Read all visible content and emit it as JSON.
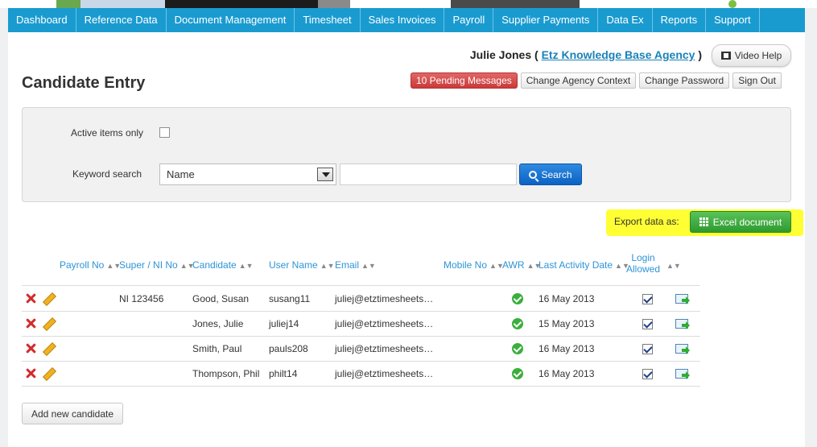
{
  "nav": {
    "items": [
      "Dashboard",
      "Reference Data",
      "Document Management",
      "Timesheet",
      "Sales Invoices",
      "Payroll",
      "Supplier Payments",
      "Data Ex",
      "Reports",
      "Support"
    ]
  },
  "header": {
    "user_name": "Julie Jones",
    "paren_open": "(",
    "agency": "Etz Knowledge Base Agency",
    "paren_close": ")",
    "video_help": "Video Help",
    "page_title": "Candidate Entry",
    "pending_messages": "10 Pending Messages",
    "change_agency": "Change Agency Context",
    "change_password": "Change Password",
    "sign_out": "Sign Out"
  },
  "filter": {
    "active_label": "Active items only",
    "keyword_label": "Keyword search",
    "select_value": "Name",
    "search_value": "",
    "search_button": "Search"
  },
  "export": {
    "label": "Export data as:",
    "excel": "Excel document",
    "highlight_color": "#ffff33"
  },
  "table": {
    "headers": [
      "Payroll No",
      "Super / NI No",
      "Candidate",
      "User Name",
      "Email",
      "Mobile No",
      "AWR",
      "Last Activity Date",
      "Login",
      "Allowed"
    ],
    "rows": [
      {
        "payroll": "",
        "ni": "NI 123456",
        "candidate": "Good, Susan",
        "username": "susang11",
        "email": "juliej@etztimesheets…",
        "mobile": "",
        "last_activity": "16 May 2013"
      },
      {
        "payroll": "",
        "ni": "",
        "candidate": "Jones, Julie",
        "username": "juliej14",
        "email": "juliej@etztimesheets…",
        "mobile": "",
        "last_activity": "15 May 2013"
      },
      {
        "payroll": "",
        "ni": "",
        "candidate": "Smith, Paul",
        "username": "pauls208",
        "email": "juliej@etztimesheets…",
        "mobile": "",
        "last_activity": "16 May 2013"
      },
      {
        "payroll": "",
        "ni": "",
        "candidate": "Thompson, Phil",
        "username": "philt14",
        "email": "juliej@etztimesheets…",
        "mobile": "",
        "last_activity": "16 May 2013"
      }
    ]
  },
  "actions": {
    "add_candidate": "Add new candidate"
  },
  "colors": {
    "nav": "#1a9bd0",
    "link": "#2e94d6",
    "danger": "#c93a3a",
    "primary": "#0b62c4",
    "success": "#2e9a2e"
  }
}
